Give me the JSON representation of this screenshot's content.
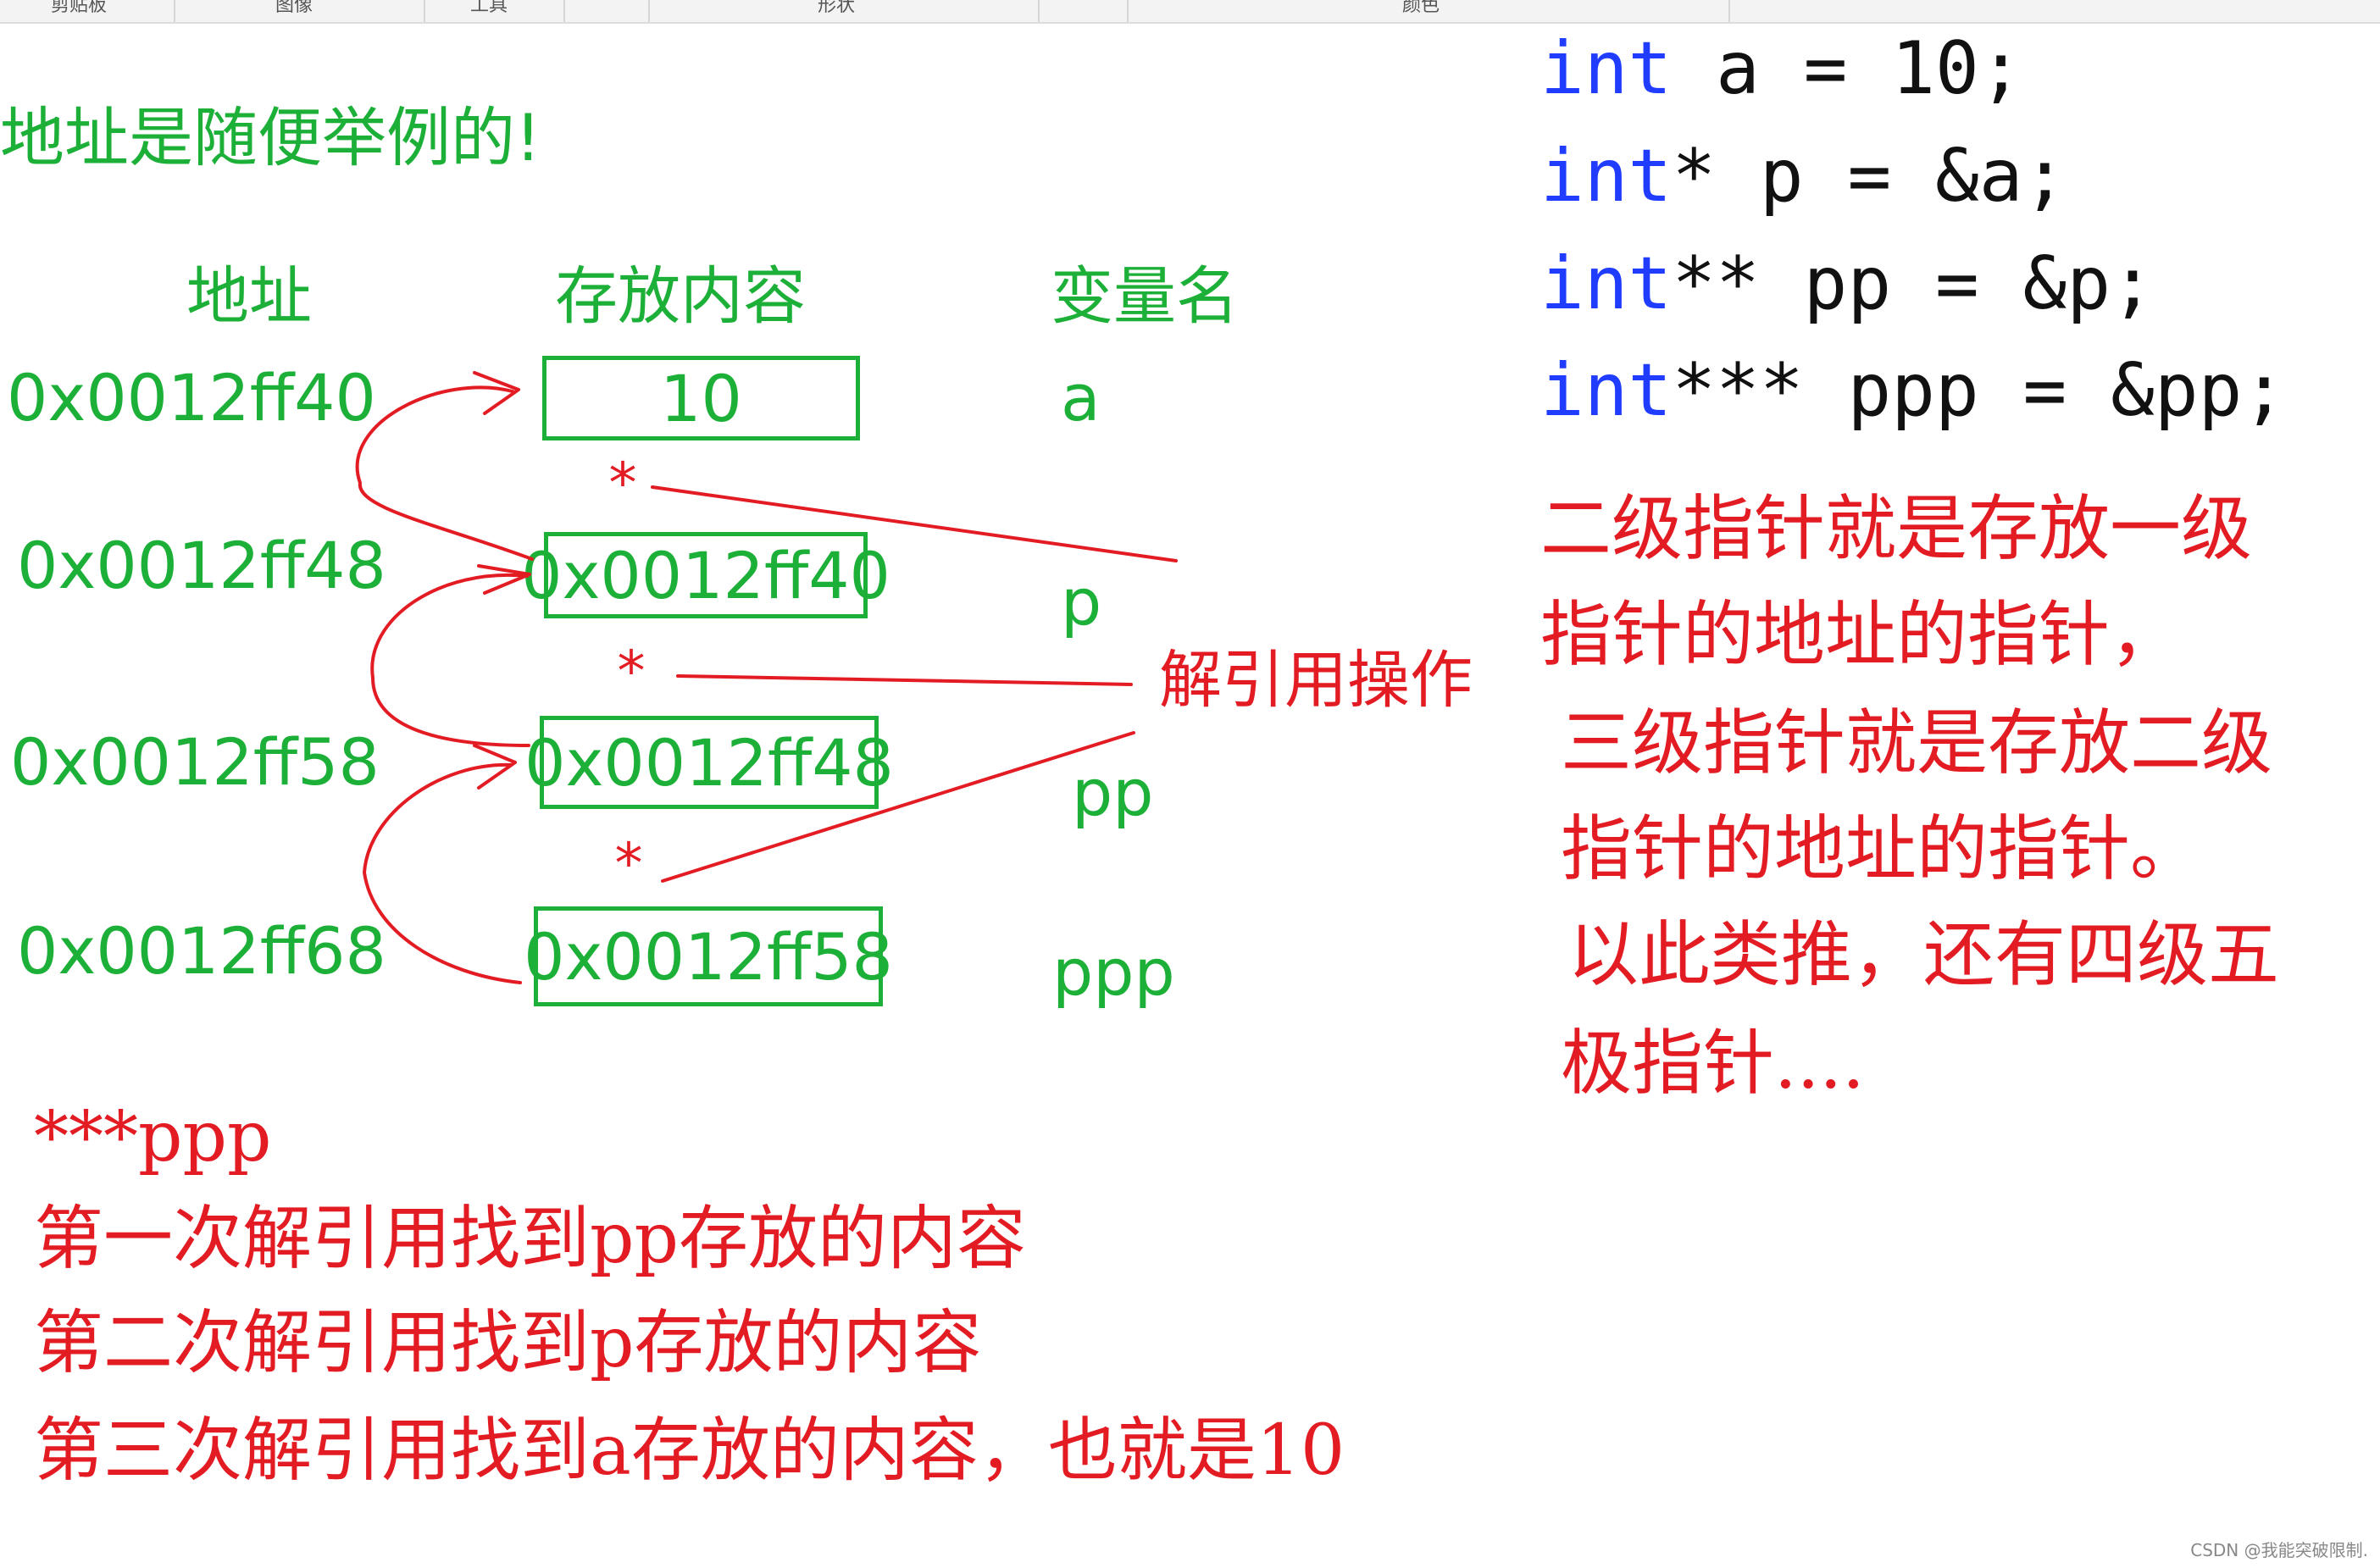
{
  "toolbar": {
    "groups": [
      "剪贴板",
      "图像",
      "工具",
      "形状",
      "颜色"
    ]
  },
  "diagram": {
    "note": "地址是随便举例的!",
    "headers": {
      "address": "地址",
      "content": "存放内容",
      "name": "变量名"
    },
    "rows": [
      {
        "address": "0x0012ff40",
        "content": "10",
        "name": "a"
      },
      {
        "address": "0x0012ff48",
        "content": "0x0012ff40",
        "name": "p"
      },
      {
        "address": "0x0012ff58",
        "content": "0x0012ff48",
        "name": "pp"
      },
      {
        "address": "0x0012ff68",
        "content": "0x0012ff58",
        "name": "ppp"
      }
    ],
    "deref_label": "解引用操作",
    "star": "*"
  },
  "code": [
    {
      "kw": "int",
      "rest": " a = 10;"
    },
    {
      "kw": "int",
      "rest": "* p = &a;"
    },
    {
      "kw": "int",
      "rest": "** pp = &p;"
    },
    {
      "kw": "int",
      "rest": "*** ppp = &pp;"
    }
  ],
  "explanation": [
    "二级指针就是存放一级",
    "指针的地址的指针，",
    "三级指针就是存放二级",
    "指针的地址的指针。",
    "以此类推，还有四级五",
    "极指针...."
  ],
  "bottom_text": [
    "***ppp",
    "第一次解引用找到pp存放的内容",
    "第二次解引用找到p存放的内容",
    "第三次解引用找到a存放的内容，也就是10"
  ],
  "watermark": "CSDN @我能突破限制.",
  "colors": {
    "green": "#1db038",
    "red": "#e31c24",
    "keyword": "#1f3cff"
  }
}
